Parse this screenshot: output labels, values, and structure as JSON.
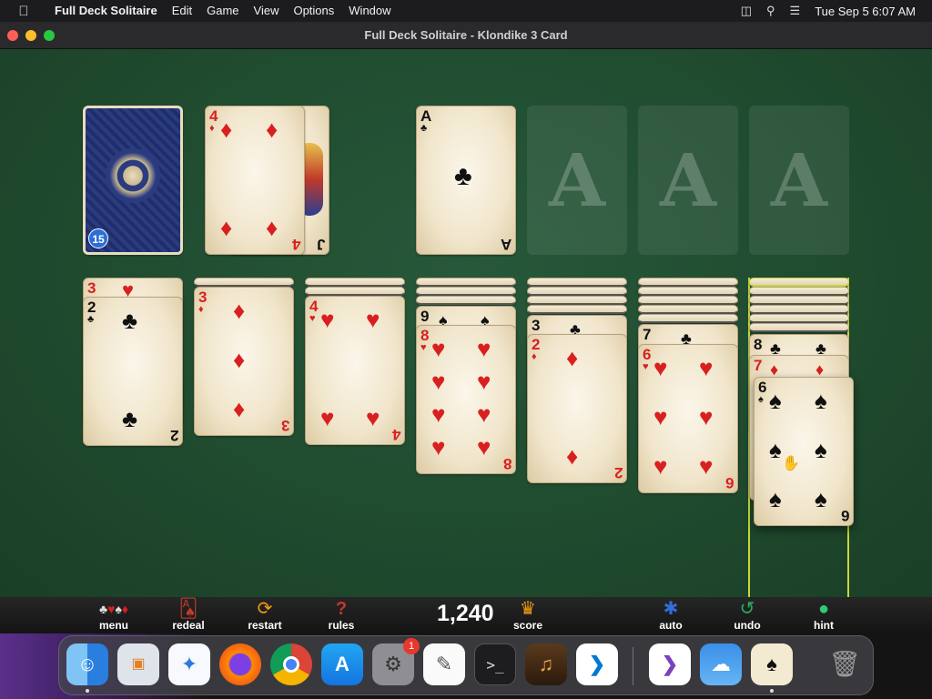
{
  "menubar": {
    "apple": "",
    "app_name": "Full Deck Solitaire",
    "items": [
      "Edit",
      "Game",
      "View",
      "Options",
      "Window"
    ],
    "clock": "Tue Sep 5  6:07 AM"
  },
  "window": {
    "title": "Full Deck Solitaire - Klondike 3 Card"
  },
  "stock": {
    "count": "15"
  },
  "waste": [
    {
      "rank": "J",
      "suit": "♠",
      "color": "black"
    },
    {
      "rank": "4",
      "suit": "♦",
      "color": "red"
    }
  ],
  "foundations": [
    {
      "rank": "A",
      "suit": "♣",
      "color": "black"
    },
    {
      "placeholder": "A"
    },
    {
      "placeholder": "A"
    },
    {
      "placeholder": "A"
    }
  ],
  "tableau": [
    {
      "hidden": 0,
      "cards": [
        {
          "rank": "3",
          "suit": "♥",
          "color": "red"
        },
        {
          "rank": "2",
          "suit": "♣",
          "color": "black"
        }
      ]
    },
    {
      "hidden": 1,
      "cards": [
        {
          "rank": "3",
          "suit": "♦",
          "color": "red"
        }
      ]
    },
    {
      "hidden": 2,
      "cards": [
        {
          "rank": "4",
          "suit": "♥",
          "color": "red"
        }
      ]
    },
    {
      "hidden": 3,
      "cards": [
        {
          "rank": "9",
          "suit": "♠",
          "color": "black"
        },
        {
          "rank": "8",
          "suit": "♥",
          "color": "red"
        }
      ]
    },
    {
      "hidden": 4,
      "cards": [
        {
          "rank": "3",
          "suit": "♣",
          "color": "black"
        },
        {
          "rank": "2",
          "suit": "♦",
          "color": "red"
        }
      ]
    },
    {
      "hidden": 5,
      "cards": [
        {
          "rank": "7",
          "suit": "♣",
          "color": "black"
        },
        {
          "rank": "6",
          "suit": "♥",
          "color": "red"
        }
      ]
    },
    {
      "hidden": 6,
      "cards": [
        {
          "rank": "8",
          "suit": "♣",
          "color": "black"
        },
        {
          "rank": "7",
          "suit": "♦",
          "color": "red"
        },
        {
          "rank": "6",
          "suit": "♠",
          "color": "black"
        }
      ]
    }
  ],
  "toolbar": {
    "menu": "menu",
    "redeal": "redeal",
    "restart": "restart",
    "rules": "rules",
    "score_value": "1,240",
    "score_label": "score",
    "auto": "auto",
    "undo": "undo",
    "hint": "hint"
  },
  "dock": {
    "apps": [
      "finder",
      "launchpad",
      "safari",
      "firefox",
      "chrome",
      "app-store",
      "system-settings",
      "textedit",
      "terminal",
      "garageband",
      "vscode",
      "visual-studio",
      "weather",
      "full-deck-solitaire",
      "trash"
    ],
    "settings_badge": "1"
  },
  "colors": {
    "felt": "#1e4a2c",
    "card_red": "#d92020",
    "card_black": "#111111",
    "selection": "#c8d83a"
  }
}
